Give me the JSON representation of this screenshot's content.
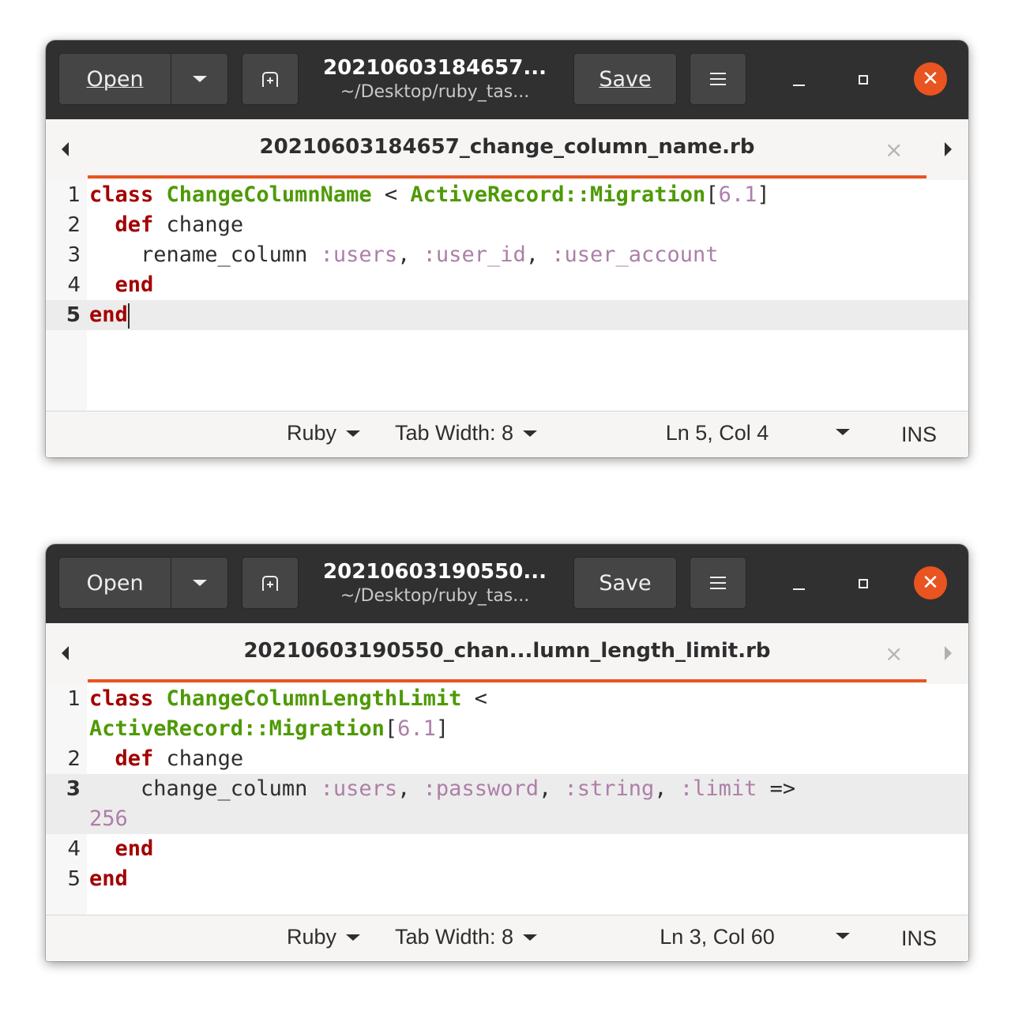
{
  "windows": [
    {
      "headerbar": {
        "open_label": "Open",
        "save_label": "Save",
        "title": "20210603184657...",
        "subtitle": "~/Desktop/ruby_tas..."
      },
      "tab": {
        "title": "20210603184657_change_column_name.rb",
        "close_glyph": "×"
      },
      "editor": {
        "line_numbers": [
          "1",
          "2",
          "3",
          "4",
          "5"
        ],
        "lines": [
          [
            "class",
            " ",
            "ChangeColumnName",
            " < ",
            "ActiveRecord::Migration",
            "[",
            "6.1",
            "]"
          ],
          [
            "  ",
            "def",
            " change"
          ],
          [
            "    rename_column ",
            ":users",
            ", ",
            ":user_id",
            ", ",
            ":user_account"
          ],
          [
            "  ",
            "end"
          ],
          [
            "end"
          ]
        ]
      },
      "statusbar": {
        "language": "Ruby",
        "tab_width": "Tab Width: 8",
        "position": "Ln 5, Col 4",
        "mode": "INS"
      }
    },
    {
      "headerbar": {
        "open_label": "Open",
        "save_label": "Save",
        "title": "20210603190550...",
        "subtitle": "~/Desktop/ruby_tas..."
      },
      "tab": {
        "title": "20210603190550_chan...lumn_length_limit.rb",
        "close_glyph": "×"
      },
      "editor": {
        "line_numbers": [
          "1",
          "2",
          "3",
          "4",
          "5"
        ],
        "lines": [
          [
            "class",
            " ",
            "ChangeColumnLengthLimit",
            " <"
          ],
          [
            "ActiveRecord::Migration",
            "[",
            "6.1",
            "]"
          ],
          [
            "  ",
            "def",
            " change"
          ],
          [
            "    change_column ",
            ":users",
            ", ",
            ":password",
            ", ",
            ":string",
            ", ",
            ":limit",
            " =>"
          ],
          [
            "256"
          ],
          [
            "  ",
            "end"
          ],
          [
            "end"
          ]
        ]
      },
      "statusbar": {
        "language": "Ruby",
        "tab_width": "Tab Width: 8",
        "position": "Ln 3, Col 60",
        "mode": "INS"
      }
    }
  ],
  "icons": {
    "dropdown": "triangle-down",
    "new_tab": "new-tab-icon",
    "menu": "hamburger-menu-icon",
    "minimize": "minimize-icon",
    "maximize": "maximize-icon",
    "close": "close-icon",
    "tab_nav": "triangle-left-right"
  },
  "colors": {
    "headerbar_bg": "#303030",
    "accent": "#e95420",
    "keyword": "#a40000",
    "type_name": "#4e9a06",
    "symbol": "#ad7fa8",
    "current_line": "#ececec"
  }
}
